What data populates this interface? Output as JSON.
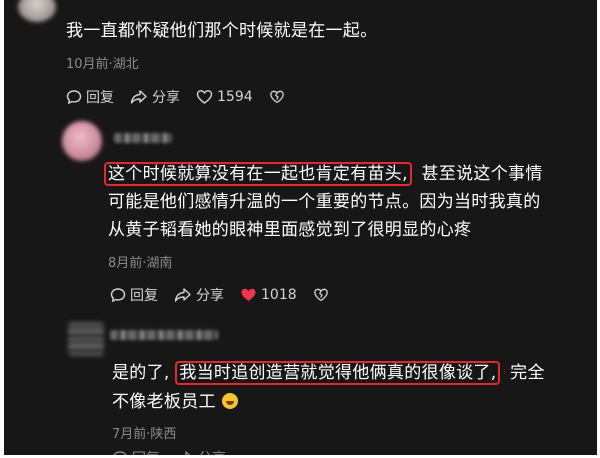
{
  "comments": [
    {
      "text": "我一直都怀疑他们那个时候就是在一起。",
      "meta": "10月前·湖北",
      "reply": "回复",
      "share": "分享",
      "likes": "1594"
    },
    {
      "text_highlight": "这个时候就算没有在一起也肯定有苗头,",
      "text_rest_1": "甚至说这个事情",
      "text_line_2": "可能是他们感情升温的一个重要的节点。因为当时我真的",
      "text_line_3": "从黄子韬看她的眼神里面感觉到了很明显的心疼",
      "meta": "8月前·湖南",
      "reply": "回复",
      "share": "分享",
      "likes": "1018"
    },
    {
      "text_pre": "是的了,",
      "text_highlight": "我当时追创造营就觉得他俩真的很像谈了,",
      "text_rest": "完全",
      "text_line_2": "不像老板员工",
      "meta": "7月前·陕西",
      "reply": "回复",
      "share": "分享"
    }
  ],
  "colors": {
    "background": "#171717",
    "highlight_border": "#e8262d",
    "liked_heart": "#f0344a"
  },
  "icons": [
    "comment-bubble-icon",
    "share-arrow-icon",
    "heart-outline-icon",
    "heart-filled-icon",
    "dislike-heart-icon",
    "laughing-emoji-icon"
  ]
}
